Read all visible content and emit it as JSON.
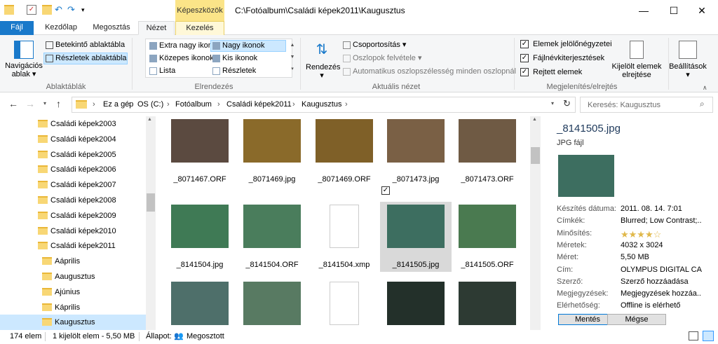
{
  "window": {
    "context_tab": "Képeszközök",
    "title": "C:\\Fotóalbum\\Családi képek2011\\Kaugusztus",
    "minimize": "—",
    "maximize": "☐",
    "close": "✕"
  },
  "tabs": [
    "Fájl",
    "Kezdőlap",
    "Megosztás",
    "Nézet",
    "Kezelés"
  ],
  "ribbon": {
    "panes": {
      "nav_pane_label": "Navigációs ablak",
      "preview": "Betekintő ablaktábla",
      "details": "Részletek ablaktábla",
      "group": "Ablaktáblák"
    },
    "layout": {
      "items": [
        "Extra nagy ikonok",
        "Nagy ikonok",
        "Közepes ikonok",
        "Kis ikonok",
        "Lista",
        "Részletek"
      ],
      "group": "Elrendezés"
    },
    "current_view": {
      "sort": "Rendezés",
      "group_by": "Csoportosítás",
      "add_columns": "Oszlopok felvétele",
      "autofit": "Automatikus oszlopszélesség minden oszlopnál",
      "group": "Aktuális nézet"
    },
    "show_hide": {
      "checkboxes": "Elemek jelölőnégyzetei",
      "extensions": "Fájlnévkiterjesztések",
      "hidden": "Rejtett elemek",
      "hide_selected": "Kijelölt elemek elrejtése",
      "options": "Beállítások",
      "group": "Megjelenítés/elrejtés"
    }
  },
  "address": {
    "crumbs": [
      "Ez a gép",
      "OS (C:)",
      "Fotóalbum",
      "Családi képek2011",
      "Kaugusztus"
    ],
    "search_placeholder": "Keresés: Kaugusztus"
  },
  "nav_items": [
    "Családi képek2003",
    "Családi képek2004",
    "Családi képek2005",
    "Családi képek2006",
    "Családi képek2007",
    "Családi képek2008",
    "Családi képek2009",
    "Családi képek2010",
    "Családi képek2011",
    "Aáprilis",
    "Aaugusztus",
    "Ajúnius",
    "Káprilis",
    "Kaugusztus"
  ],
  "files": [
    {
      "name": "_8071467.ORF",
      "color": "#5b4a40"
    },
    {
      "name": "_8071469.jpg",
      "color": "#8a6a2a"
    },
    {
      "name": "_8071469.ORF",
      "color": "#7f6028"
    },
    {
      "name": "_8071473.jpg",
      "color": "#7a6045"
    },
    {
      "name": "_8071473.ORF",
      "color": "#6f5a44"
    },
    {
      "name": "_8141504.jpg",
      "color": "#3f7a55"
    },
    {
      "name": "_8141504.ORF",
      "color": "#4a7d5c"
    },
    {
      "name": "_8141504.xmp",
      "color": "#ffffff"
    },
    {
      "name": "_8141505.jpg",
      "color": "#3d6e60"
    },
    {
      "name": "_8141505.ORF",
      "color": "#4a7a50"
    },
    {
      "name": "",
      "color": "#4e6f6a"
    },
    {
      "name": "",
      "color": "#587a62"
    },
    {
      "name": "",
      "color": "#ffffff"
    },
    {
      "name": "",
      "color": "#23302a"
    },
    {
      "name": "",
      "color": "#2d3a33"
    }
  ],
  "details": {
    "filename": "_8141505.jpg",
    "filetype": "JPG fájl",
    "rows": [
      {
        "label": "Készítés dátuma:",
        "value": "2011. 08. 14. 7:01"
      },
      {
        "label": "Címkék:",
        "value": "Blurred; Low Contrast;..."
      },
      {
        "label": "Minősítés:",
        "value": "★★★★☆"
      },
      {
        "label": "Méretek:",
        "value": "4032 x 3024"
      },
      {
        "label": "Méret:",
        "value": "5,50 MB"
      },
      {
        "label": "Cím:",
        "value": "OLYMPUS DIGITAL CA..."
      },
      {
        "label": "Szerző:",
        "value": "Szerző hozzáadása"
      },
      {
        "label": "Megjegyzések:",
        "value": "Megjegyzések hozzáa..."
      },
      {
        "label": "Elérhetőség:",
        "value": "Offline is elérhető"
      }
    ],
    "save": "Mentés",
    "cancel": "Mégse"
  },
  "status": {
    "count": "174 elem",
    "selected": "1 kijelölt elem - 5,50 MB",
    "state_label": "Állapot:",
    "state_value": "Megosztott"
  },
  "colors": {
    "accent": "#1979ca",
    "selection": "#cce8ff",
    "context_tab": "#fbe488"
  }
}
